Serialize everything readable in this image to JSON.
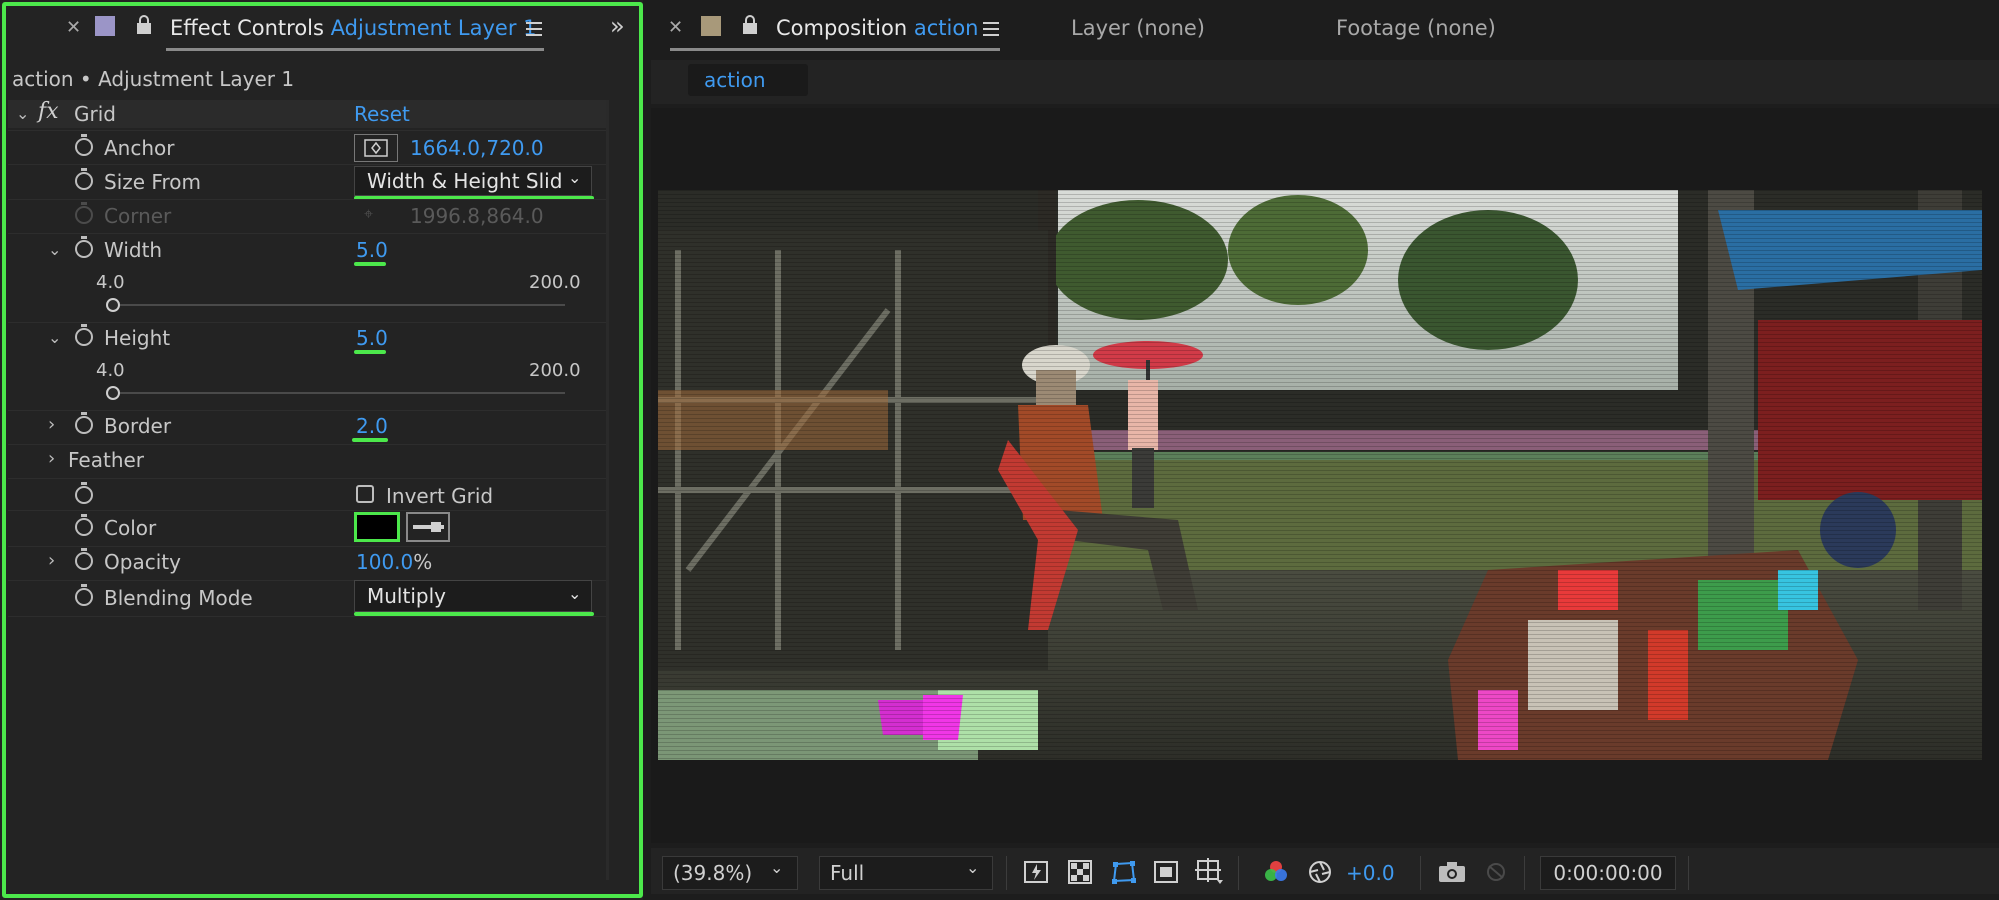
{
  "effect_controls": {
    "tab_title": "Effect Controls",
    "tab_layer": "Adjustment Layer 1",
    "breadcrumb": "action • Adjustment Layer 1",
    "effect_name": "Grid",
    "reset_label": "Reset",
    "properties": {
      "anchor": {
        "label": "Anchor",
        "value": "1664.0,720.0"
      },
      "size_from": {
        "label": "Size From",
        "value": "Width & Height Slid"
      },
      "corner": {
        "label": "Corner",
        "value": "1996.8,864.0"
      },
      "width": {
        "label": "Width",
        "value": "5.0",
        "min": "4.0",
        "max": "200.0"
      },
      "height": {
        "label": "Height",
        "value": "5.0",
        "min": "4.0",
        "max": "200.0"
      },
      "border": {
        "label": "Border",
        "value": "2.0"
      },
      "feather": {
        "label": "Feather"
      },
      "invert_grid": {
        "label": "Invert Grid",
        "checked": false
      },
      "color": {
        "label": "Color",
        "swatch": "#000000"
      },
      "opacity": {
        "label": "Opacity",
        "value": "100.0",
        "unit": "%"
      },
      "blending_mode": {
        "label": "Blending Mode",
        "value": "Multiply"
      }
    }
  },
  "composition": {
    "tab_title": "Composition",
    "tab_comp": "action",
    "layer_tab": "Layer (none)",
    "footage_tab": "Footage (none)",
    "comp_chip": "action"
  },
  "viewer_toolbar": {
    "zoom": "(39.8%)",
    "resolution": "Full",
    "exposure": "+0.0",
    "timecode": "0:00:00:00"
  },
  "colors": {
    "accent_blue": "#3f9af0",
    "highlight_green": "#4ce84b",
    "panel_bg": "#232323"
  }
}
